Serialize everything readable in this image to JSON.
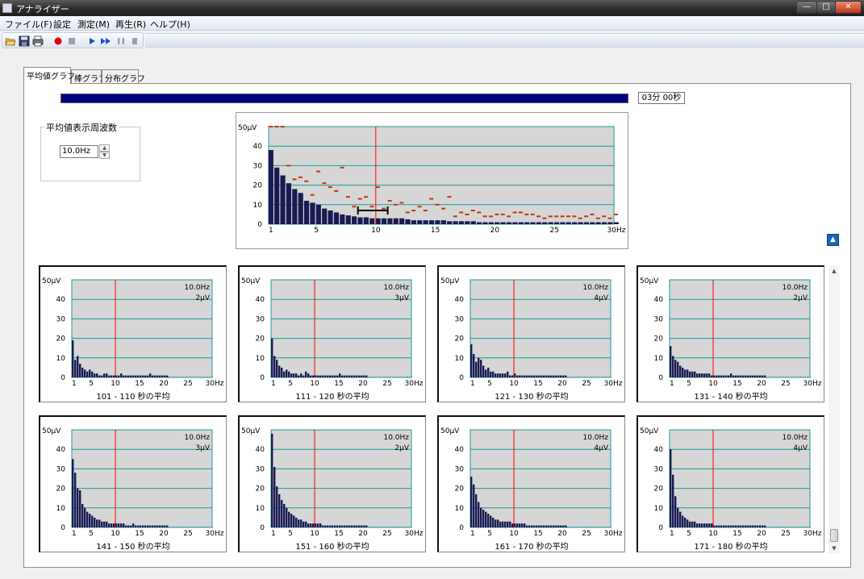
{
  "window": {
    "title": "アナライザー",
    "buttons": {
      "minimize": "—",
      "maximize": "□",
      "close": "✕"
    }
  },
  "menu": [
    {
      "label": "ファイル(F)"
    },
    {
      "label": "設定"
    },
    {
      "label": "測定(M)"
    },
    {
      "label": "再生(R)"
    },
    {
      "label": "ヘルプ(H)"
    }
  ],
  "toolbar": {
    "buttons": [
      "open-icon",
      "save-icon",
      "print-icon",
      "record-icon",
      "stop-icon",
      "play-icon",
      "fast-forward-icon",
      "pause-icon",
      "stop-playback-icon"
    ],
    "record_color": "#e00000",
    "play_color": "#1e4fd0"
  },
  "tabs": [
    {
      "label": "平均値グラフ",
      "active": true
    },
    {
      "label": "棒グラフ",
      "active": false
    },
    {
      "label": "分布グラフ",
      "active": false
    }
  ],
  "progress": {
    "fraction": 1.0,
    "elapsed_text": "03分 00秒",
    "color": "#000080"
  },
  "frequency_setting": {
    "group_label": "平均値表示周波数",
    "value": "10.0Hz"
  },
  "chart_style": {
    "plot_bg": "#d6d6d6",
    "grid": "#1e9a9a",
    "bar": "#1a1a52",
    "marker": "#cc3300",
    "cursor": "#ff0000"
  },
  "main_chart": {
    "type": "bar",
    "y_unit_label": "50μV",
    "y_ticks": [
      "40",
      "30",
      "20",
      "10",
      "0"
    ],
    "x_ticks": [
      "1",
      "5",
      "10",
      "15",
      "20",
      "25",
      "30Hz"
    ],
    "chart_data": {
      "type": "bar",
      "x": [
        1,
        1.5,
        2,
        2.5,
        3,
        3.5,
        4,
        4.5,
        5,
        5.5,
        6,
        6.5,
        7,
        7.5,
        8,
        8.5,
        9,
        9.5,
        10,
        10.5,
        11,
        11.5,
        12,
        12.5,
        13,
        13.5,
        14,
        14.5,
        15,
        15.5,
        16,
        16.5,
        17,
        17.5,
        18,
        18.5,
        19,
        19.5,
        20,
        20.5,
        21,
        21.5,
        22,
        22.5,
        23,
        23.5,
        24,
        24.5,
        25,
        25.5,
        26,
        26.5,
        27,
        27.5,
        28,
        28.5,
        29,
        29.5,
        30
      ],
      "values": [
        38,
        29,
        25,
        21,
        18,
        16,
        12,
        11,
        10,
        8,
        7,
        6,
        5,
        4.5,
        4,
        3.5,
        3.5,
        3,
        3,
        3,
        3,
        3,
        3,
        2.5,
        2,
        2,
        2,
        2,
        2,
        2,
        1.5,
        1.5,
        1.5,
        1.5,
        1.5,
        1,
        1,
        1,
        1,
        1,
        1,
        1,
        1,
        1,
        1,
        1,
        1,
        1,
        1,
        1,
        1,
        1,
        1,
        1,
        1,
        1,
        1,
        1,
        1
      ],
      "peak_markers": {
        "x": [
          1,
          1.5,
          2,
          2.5,
          3,
          3.5,
          4,
          4.5,
          5,
          5.5,
          6,
          6.5,
          7,
          7.5,
          8,
          8.5,
          9,
          9.5,
          10,
          10.5,
          11,
          11.5,
          12,
          12.5,
          13,
          13.5,
          14,
          14.5,
          15,
          15.5,
          16,
          16.5,
          17,
          17.5,
          18,
          18.5,
          19,
          19.5,
          20,
          20.5,
          21,
          21.5,
          22,
          22.5,
          23,
          23.5,
          24,
          24.5,
          25,
          25.5,
          26,
          26.5,
          27,
          27.5,
          28,
          28.5,
          29,
          29.5,
          30
        ],
        "values": [
          50,
          50,
          50,
          30,
          23,
          24,
          22,
          15,
          27,
          21,
          19,
          17,
          29,
          14,
          9,
          13,
          14,
          9,
          19,
          8,
          12,
          10,
          11,
          6,
          7,
          9,
          7,
          13,
          10,
          8,
          14,
          4,
          6,
          5,
          7,
          6,
          4,
          4,
          5,
          5,
          4,
          6,
          6,
          5,
          5,
          4,
          3,
          4,
          4,
          4,
          4,
          4,
          3,
          4,
          5,
          3,
          4,
          3,
          5
        ]
      },
      "cursor_x": 10,
      "error_bar": {
        "x_from": 8.5,
        "x_to": 11,
        "y": 7
      },
      "ylim": [
        0,
        50
      ],
      "xlim": [
        1,
        30
      ]
    }
  },
  "mini_charts": [
    {
      "label": "101 - 110 秒の平均",
      "freq_text": "10.0Hz",
      "value_text": "2μV",
      "chart_data": {
        "type": "bar",
        "values": [
          19,
          9,
          11,
          7,
          5,
          4,
          3,
          4,
          3,
          2,
          2,
          1,
          1,
          2,
          2,
          1,
          1,
          1,
          1,
          1,
          2,
          1,
          1,
          1,
          1,
          1,
          1,
          1,
          1,
          1,
          1,
          1,
          2,
          1,
          1,
          1,
          1,
          1,
          1,
          1
        ],
        "cursor_x": 10
      }
    },
    {
      "label": "111 - 120 秒の平均",
      "freq_text": "10.0Hz",
      "value_text": "3μV",
      "chart_data": {
        "type": "bar",
        "values": [
          20,
          11,
          9,
          6,
          5,
          3,
          4,
          3,
          2,
          2,
          2,
          1,
          2,
          1,
          3,
          2,
          1,
          1,
          1,
          1,
          1,
          1,
          1,
          1,
          1,
          1,
          1,
          1,
          2,
          1,
          1,
          1,
          1,
          1,
          1,
          1,
          1,
          1,
          1,
          1
        ],
        "cursor_x": 10
      }
    },
    {
      "label": "121 - 130 秒の平均",
      "freq_text": "10.0Hz",
      "value_text": "4μV",
      "chart_data": {
        "type": "bar",
        "values": [
          17,
          12,
          8,
          10,
          9,
          6,
          4,
          5,
          3,
          3,
          2,
          2,
          2,
          2,
          2,
          3,
          1,
          1,
          2,
          1,
          1,
          1,
          1,
          1,
          1,
          1,
          1,
          1,
          1,
          1,
          1,
          1,
          1,
          1,
          1,
          1,
          1,
          1,
          1,
          1
        ],
        "cursor_x": 10
      }
    },
    {
      "label": "131 - 140 秒の平均",
      "freq_text": "10.0Hz",
      "value_text": "2μV",
      "chart_data": {
        "type": "bar",
        "values": [
          16,
          11,
          9,
          8,
          6,
          5,
          4,
          4,
          3,
          3,
          3,
          2,
          2,
          2,
          2,
          2,
          2,
          1,
          1,
          1,
          1,
          1,
          1,
          1,
          1,
          2,
          1,
          1,
          1,
          1,
          1,
          1,
          1,
          1,
          1,
          1,
          1,
          1,
          1,
          1
        ],
        "cursor_x": 10
      }
    },
    {
      "label": "141 - 150 秒の平均",
      "freq_text": "10.0Hz",
      "value_text": "3μV",
      "chart_data": {
        "type": "bar",
        "values": [
          35,
          28,
          20,
          19,
          12,
          10,
          8,
          7,
          6,
          5,
          4,
          4,
          3,
          3,
          3,
          2,
          2,
          2,
          2,
          2,
          2,
          2,
          1,
          1,
          1,
          2,
          1,
          1,
          1,
          1,
          1,
          1,
          1,
          1,
          1,
          1,
          1,
          1,
          1,
          1
        ],
        "cursor_x": 10
      }
    },
    {
      "label": "151 - 160 秒の平均",
      "freq_text": "10.0Hz",
      "value_text": "2μV",
      "chart_data": {
        "type": "bar",
        "values": [
          48,
          31,
          21,
          17,
          14,
          12,
          10,
          8,
          7,
          6,
          5,
          4,
          4,
          3,
          3,
          2,
          2,
          2,
          2,
          2,
          2,
          1,
          1,
          1,
          1,
          1,
          1,
          1,
          1,
          1,
          1,
          1,
          1,
          1,
          1,
          1,
          1,
          1,
          1,
          1
        ],
        "cursor_x": 10
      }
    },
    {
      "label": "161 - 170 秒の平均",
      "freq_text": "10.0Hz",
      "value_text": "4μV",
      "chart_data": {
        "type": "bar",
        "values": [
          26,
          22,
          17,
          13,
          10,
          9,
          8,
          7,
          6,
          5,
          4,
          4,
          3,
          3,
          3,
          3,
          3,
          2,
          2,
          2,
          2,
          2,
          2,
          1,
          1,
          1,
          1,
          1,
          1,
          1,
          1,
          1,
          1,
          1,
          1,
          1,
          1,
          1,
          1,
          1
        ],
        "cursor_x": 10
      }
    },
    {
      "label": "171 - 180 秒の平均",
      "freq_text": "10.0Hz",
      "value_text": "4μV",
      "chart_data": {
        "type": "bar",
        "values": [
          40,
          27,
          16,
          10,
          8,
          6,
          5,
          4,
          3,
          3,
          3,
          2,
          2,
          2,
          2,
          2,
          2,
          2,
          1,
          1,
          1,
          1,
          1,
          1,
          1,
          1,
          1,
          1,
          1,
          1,
          1,
          1,
          1,
          1,
          1,
          1,
          1,
          1,
          1,
          1
        ],
        "cursor_x": 10
      }
    }
  ],
  "mini_axis": {
    "y_unit_label": "50μV",
    "y_ticks": [
      "40",
      "30",
      "20",
      "10",
      "0"
    ],
    "x_ticks": [
      "1",
      "5",
      "10",
      "15",
      "20",
      "25",
      "30Hz"
    ]
  },
  "scrollbar": {
    "up": "▲",
    "down": "▼"
  },
  "collapse_button": "▲"
}
